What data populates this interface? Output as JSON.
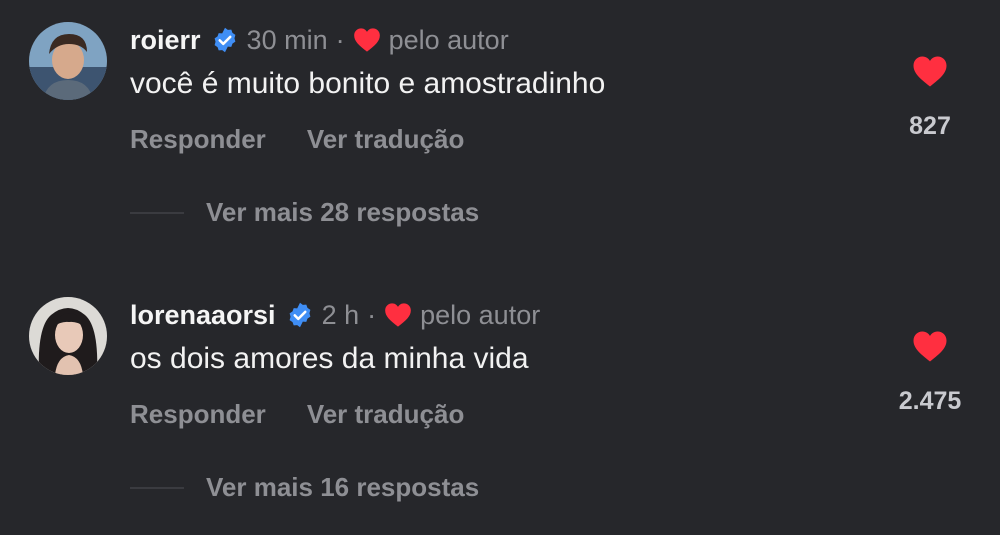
{
  "comments": [
    {
      "username": "roierr",
      "time": "30 min",
      "separator": "·",
      "by_author": "pelo autor",
      "text": "você é muito bonito e amostradinho",
      "reply_label": "Responder",
      "translate_label": "Ver tradução",
      "like_count": "827",
      "view_replies": "Ver mais 28 respostas",
      "verified": true
    },
    {
      "username": "lorenaaorsi",
      "time": "2 h",
      "separator": "·",
      "by_author": "pelo autor",
      "text": "os dois amores da minha vida",
      "reply_label": "Responder",
      "translate_label": "Ver tradução",
      "like_count": "2.475",
      "view_replies": "Ver mais 16 respostas",
      "verified": true
    }
  ],
  "colors": {
    "background": "#26272b",
    "heart": "#ff2f40",
    "verified": "#3f8ef5",
    "muted": "#8e8f94"
  },
  "icons": {
    "verified": "verified-badge-icon",
    "liked_by_author": "heart-icon",
    "like_button": "heart-filled-icon"
  }
}
